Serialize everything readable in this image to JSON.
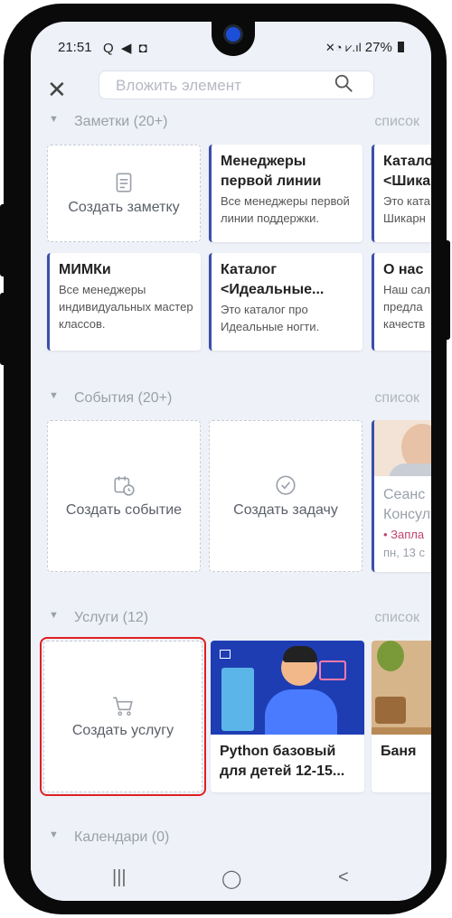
{
  "status": {
    "time": "21:51",
    "left_icons": "Q ◀ ◘",
    "battery": "27%",
    "signal_icons": "✕◔ ⩗.ıl"
  },
  "topbar": {
    "close_icon": "close-icon",
    "search_placeholder": "Вложить элемент"
  },
  "notes": {
    "header": "Заметки (20+)",
    "link": "список",
    "create_label": "Создать заметку",
    "items": [
      {
        "title": "Менеджеры первой линии",
        "desc": "Все менеджеры первой линии поддержки."
      },
      {
        "title": "Катало <Шика",
        "desc": "Это ката Шикарн"
      },
      {
        "title": "МИМКи",
        "desc": "Все менеджеры индивидуальных мастер классов."
      },
      {
        "title": "Каталог <Идеальные...",
        "desc": "Это каталог про Идеальные ногти."
      },
      {
        "title": "О нас",
        "desc": "Наш сал предла качеств"
      }
    ]
  },
  "events": {
    "header": "События (20+)",
    "link": "список",
    "create_event_label": "Создать событие",
    "create_task_label": "Создать задачу",
    "partial": {
      "title": "Сеанс Консул",
      "status": "• Запла",
      "date": "пн, 13 с"
    }
  },
  "services": {
    "header": "Услуги (12)",
    "link": "список",
    "create_label": "Создать услугу",
    "items": [
      {
        "title": "Python базовый для детей 12-15..."
      },
      {
        "title": "Баня"
      }
    ]
  },
  "calendars": {
    "header": "Календари (0)"
  },
  "navbar": {
    "recent": "|||",
    "home": "◯",
    "back": "<"
  },
  "colors": {
    "accent": "#3b4fa8",
    "highlight": "#e02020",
    "event_status": "#c0446a"
  }
}
